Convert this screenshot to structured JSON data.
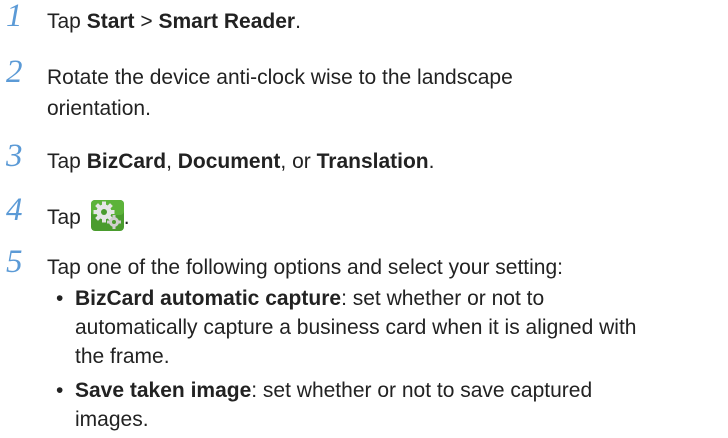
{
  "steps": [
    {
      "number": "1",
      "prefix": "Tap ",
      "start": "Start",
      "sep": " > ",
      "reader": "Smart Reader",
      "end": "."
    },
    {
      "number": "2",
      "line1": "Rotate the device anti-clock wise to the landscape",
      "line2": "orientation."
    },
    {
      "number": "3",
      "prefix": "Tap ",
      "bizcard": "BizCard",
      "comma": ", ",
      "document": "Document",
      "or": ", or ",
      "translation": "Translation",
      "end": "."
    },
    {
      "number": "4",
      "prefix": "Tap ",
      "icon": "settings-gear-icon",
      "end": "."
    },
    {
      "number": "5",
      "text": "Tap one of the following options and select your setting:"
    }
  ],
  "bullets": [
    {
      "symbol": "•",
      "term": "BizCard automatic capture",
      "line1": ": set whether or not to",
      "line2": "automatically capture a business card when it is aligned with",
      "line3": "the frame."
    },
    {
      "symbol": "•",
      "term": "Save taken image",
      "line1": ": set whether or not to save captured",
      "line2": "images."
    }
  ],
  "colors": {
    "step_number": "#5b9ad6",
    "icon_green": "#4a9c2e",
    "icon_gear": "#e6e6e6"
  }
}
